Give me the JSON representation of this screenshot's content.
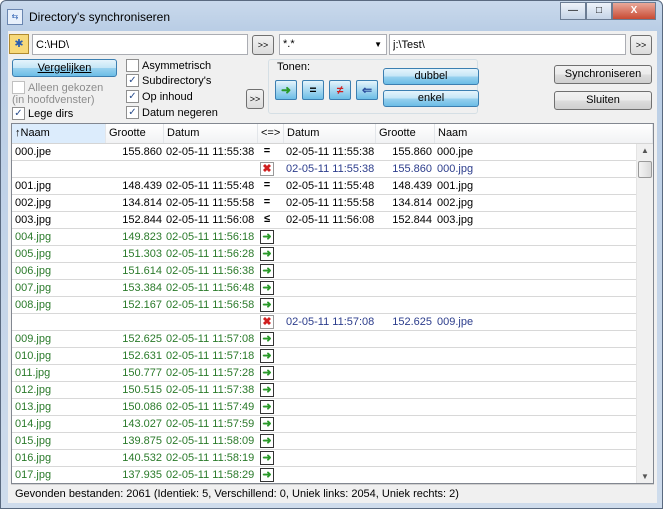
{
  "window": {
    "title": "Directory's synchroniseren",
    "min": "—",
    "max": "□",
    "close": "X"
  },
  "left_path": "C:\\HD\\",
  "filter": "*.*",
  "right_path": "j:\\Test\\",
  "more": ">>",
  "compare_label": "Vergelijken",
  "options": {
    "only_selected": "Alleen gekozen",
    "only_selected_sub": "(in hoofdvenster)",
    "empty_dirs": "Lege dirs",
    "asym": "Asymmetrisch",
    "subdirs": "Subdirectory's",
    "by_content": "Op inhoud",
    "ignore_date": "Datum negeren"
  },
  "show": {
    "label": "Tonen:",
    "dubbel": "dubbel",
    "enkel": "enkel",
    "right": "➜",
    "equal": "=",
    "diff": "≠",
    "left": "⇐"
  },
  "sync_label": "Synchroniseren",
  "close_label": "Sluiten",
  "columns": {
    "name": "Naam",
    "size": "Grootte",
    "date": "Datum",
    "cmp": "<=>",
    "rdate": "Datum",
    "rsize": "Grootte",
    "rname": "Naam",
    "sort_icon": "↑"
  },
  "rows": [
    {
      "t": "eq",
      "n": "000.jpe",
      "s": "155.860",
      "d": "02-05-11 11:55:38",
      "c": "=",
      "rd": "02-05-11 11:55:38",
      "rs": "155.860",
      "rn": "000.jpe"
    },
    {
      "t": "r",
      "n": "",
      "s": "",
      "d": "",
      "c": "✖",
      "rd": "02-05-11 11:55:38",
      "rs": "155.860",
      "rn": "000.jpg"
    },
    {
      "t": "eq",
      "n": "001.jpg",
      "s": "148.439",
      "d": "02-05-11 11:55:48",
      "c": "=",
      "rd": "02-05-11 11:55:48",
      "rs": "148.439",
      "rn": "001.jpg"
    },
    {
      "t": "eq",
      "n": "002.jpg",
      "s": "134.814",
      "d": "02-05-11 11:55:58",
      "c": "=",
      "rd": "02-05-11 11:55:58",
      "rs": "134.814",
      "rn": "002.jpg"
    },
    {
      "t": "eq",
      "n": "003.jpg",
      "s": "152.844",
      "d": "02-05-11 11:56:08",
      "c": "≤",
      "rd": "02-05-11 11:56:08",
      "rs": "152.844",
      "rn": "003.jpg"
    },
    {
      "t": "l",
      "n": "004.jpg",
      "s": "149.823",
      "d": "02-05-11 11:56:18",
      "c": "➜",
      "rd": "",
      "rs": "",
      "rn": ""
    },
    {
      "t": "l",
      "n": "005.jpg",
      "s": "151.303",
      "d": "02-05-11 11:56:28",
      "c": "➜",
      "rd": "",
      "rs": "",
      "rn": ""
    },
    {
      "t": "l",
      "n": "006.jpg",
      "s": "151.614",
      "d": "02-05-11 11:56:38",
      "c": "➜",
      "rd": "",
      "rs": "",
      "rn": ""
    },
    {
      "t": "l",
      "n": "007.jpg",
      "s": "153.384",
      "d": "02-05-11 11:56:48",
      "c": "➜",
      "rd": "",
      "rs": "",
      "rn": ""
    },
    {
      "t": "l",
      "n": "008.jpg",
      "s": "152.167",
      "d": "02-05-11 11:56:58",
      "c": "➜",
      "rd": "",
      "rs": "",
      "rn": ""
    },
    {
      "t": "r",
      "n": "",
      "s": "",
      "d": "",
      "c": "✖",
      "rd": "02-05-11 11:57:08",
      "rs": "152.625",
      "rn": "009.jpe"
    },
    {
      "t": "l",
      "n": "009.jpg",
      "s": "152.625",
      "d": "02-05-11 11:57:08",
      "c": "➜",
      "rd": "",
      "rs": "",
      "rn": ""
    },
    {
      "t": "l",
      "n": "010.jpg",
      "s": "152.631",
      "d": "02-05-11 11:57:18",
      "c": "➜",
      "rd": "",
      "rs": "",
      "rn": ""
    },
    {
      "t": "l",
      "n": "011.jpg",
      "s": "150.777",
      "d": "02-05-11 11:57:28",
      "c": "➜",
      "rd": "",
      "rs": "",
      "rn": ""
    },
    {
      "t": "l",
      "n": "012.jpg",
      "s": "150.515",
      "d": "02-05-11 11:57:38",
      "c": "➜",
      "rd": "",
      "rs": "",
      "rn": ""
    },
    {
      "t": "l",
      "n": "013.jpg",
      "s": "150.086",
      "d": "02-05-11 11:57:49",
      "c": "➜",
      "rd": "",
      "rs": "",
      "rn": ""
    },
    {
      "t": "l",
      "n": "014.jpg",
      "s": "143.027",
      "d": "02-05-11 11:57:59",
      "c": "➜",
      "rd": "",
      "rs": "",
      "rn": ""
    },
    {
      "t": "l",
      "n": "015.jpg",
      "s": "139.875",
      "d": "02-05-11 11:58:09",
      "c": "➜",
      "rd": "",
      "rs": "",
      "rn": ""
    },
    {
      "t": "l",
      "n": "016.jpg",
      "s": "140.532",
      "d": "02-05-11 11:58:19",
      "c": "➜",
      "rd": "",
      "rs": "",
      "rn": ""
    },
    {
      "t": "l",
      "n": "017.jpg",
      "s": "137.935",
      "d": "02-05-11 11:58:29",
      "c": "➜",
      "rd": "",
      "rs": "",
      "rn": ""
    }
  ],
  "status": "Gevonden bestanden: 2061  (Identiek: 5, Verschillend: 0, Uniek links: 2054, Uniek rechts: 2)",
  "scroll": {
    "up": "▲",
    "down": "▼"
  }
}
